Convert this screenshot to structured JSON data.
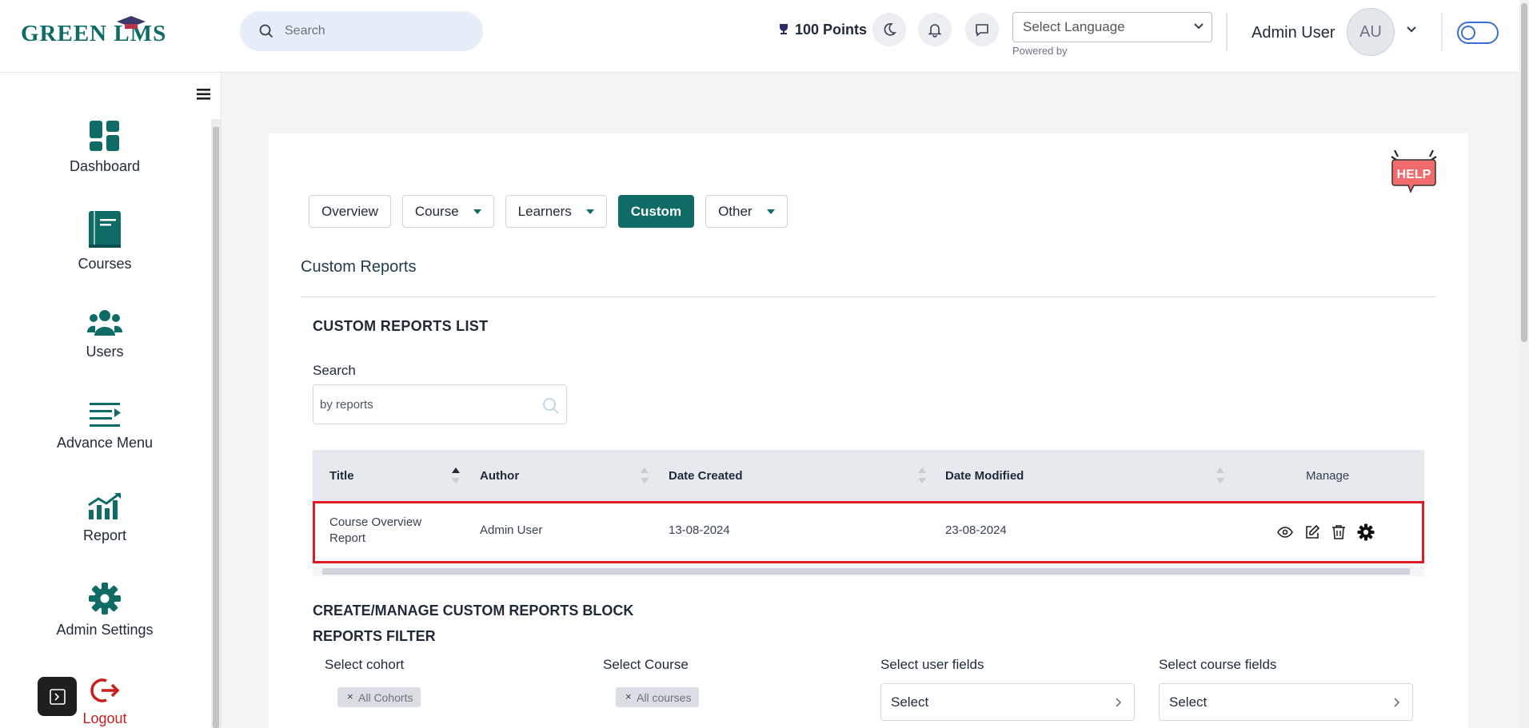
{
  "app": {
    "logo_text": "GREEN LMS"
  },
  "header": {
    "search_placeholder": "Search",
    "points": "100 Points",
    "language_select": "Select Language",
    "powered_by": "Powered by",
    "user_name": "Admin User",
    "avatar_initials": "AU"
  },
  "sidebar": {
    "items": [
      {
        "label": "Dashboard",
        "icon": "dashboard-icon"
      },
      {
        "label": "Courses",
        "icon": "book-icon"
      },
      {
        "label": "Users",
        "icon": "users-icon"
      },
      {
        "label": "Advance Menu",
        "icon": "menu-list-icon"
      },
      {
        "label": "Report",
        "icon": "chart-icon"
      },
      {
        "label": "Admin Settings",
        "icon": "gear-icon"
      },
      {
        "label": "Logout",
        "icon": "logout-icon"
      }
    ]
  },
  "tabs": [
    {
      "label": "Overview",
      "dropdown": false,
      "active": false
    },
    {
      "label": "Course",
      "dropdown": true,
      "active": false
    },
    {
      "label": "Learners",
      "dropdown": true,
      "active": false
    },
    {
      "label": "Custom",
      "dropdown": false,
      "active": true
    },
    {
      "label": "Other",
      "dropdown": true,
      "active": false
    }
  ],
  "help_label": "HELP",
  "page_title": "Custom Reports",
  "list": {
    "title": "CUSTOM REPORTS LIST",
    "search_label": "Search",
    "search_placeholder": "by reports",
    "columns": [
      "Title",
      "Author",
      "Date Created",
      "Date Modified",
      "Manage"
    ],
    "rows": [
      {
        "title_line1": "Course Overview",
        "title_line2": "Report",
        "author": "Admin User",
        "date_created": "13-08-2024",
        "date_modified": "23-08-2024"
      }
    ]
  },
  "block": {
    "title": "CREATE/MANAGE CUSTOM REPORTS BLOCK",
    "filter_title": "REPORTS FILTER",
    "cohort_label": "Select cohort",
    "cohort_chip": "All Cohorts",
    "course_label": "Select Course",
    "course_chip": "All courses",
    "user_fields_label": "Select user fields",
    "user_fields_value": "Select",
    "course_fields_label": "Select course fields",
    "course_fields_value": "Select"
  },
  "colors": {
    "brand": "#0f6b66",
    "highlight": "#e01b24",
    "logout": "#c81e1e"
  }
}
